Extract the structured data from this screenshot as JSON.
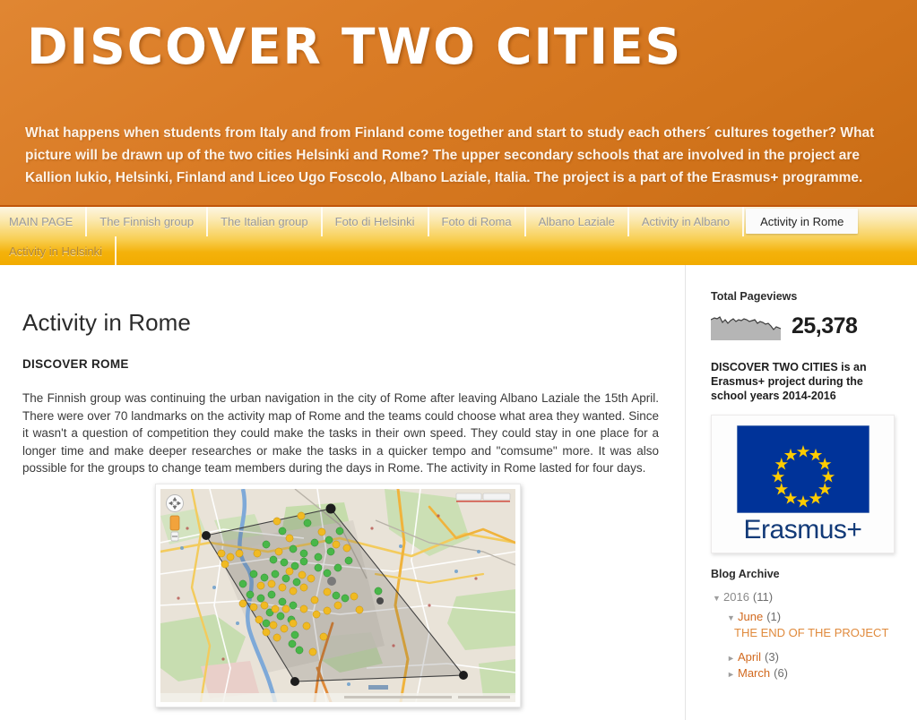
{
  "header": {
    "blog_title": "DISCOVER TWO CITIES",
    "description": "What happens when students from Italy and from Finland come together and start to study each others´ cultures together? What picture will be drawn up of the two cities Helsinki and Rome? The upper secondary schools that are involved in the project are Kallion lukio, Helsinki, Finland and Liceo Ugo Foscolo, Albano Laziale, Italia. The project is a part of the Erasmus+ programme.",
    "gradient_start": "#e08632",
    "gradient_end": "#c96c14"
  },
  "nav": {
    "row1": [
      {
        "label": "MAIN PAGE",
        "active": false
      },
      {
        "label": "The Finnish group",
        "active": false
      },
      {
        "label": "The Italian group",
        "active": false
      },
      {
        "label": "Foto di Helsinki",
        "active": false
      },
      {
        "label": "Foto di Roma",
        "active": false
      },
      {
        "label": "Albano Laziale",
        "active": false
      },
      {
        "label": "Activity in Albano",
        "active": false
      },
      {
        "label": "Activity in Rome",
        "active": true
      }
    ],
    "row2": [
      {
        "label": "Activity in Helsinki",
        "active": false
      }
    ],
    "bar_color_top": "#fdf6e2",
    "bar_color_bottom": "#f2ab00",
    "active_tab_bg": "#fbfbfb"
  },
  "post": {
    "title": "Activity in Rome",
    "subtitle": "DISCOVER ROME",
    "body": "The Finnish group was continuing the urban navigation in the city of Rome after leaving Albano Laziale the 15th April. There were over 70 landmarks on the activity map of Rome and the teams could choose what area they wanted. Since it wasn't a question of competition they could make the tasks in their own speed. They could stay in one place for a longer time and make deeper researches or make the tasks in a quicker tempo and \"comsume\" more. It was also possible for the groups to change team members during the days in Rome. The activity in Rome lasted for four days.",
    "image_alt": "Activity map of Rome with over 70 landmark markers"
  },
  "sidebar": {
    "pageviews": {
      "heading": "Total Pageviews",
      "count": "25,378",
      "chart_color": "#b5b5b5",
      "line_color": "#4a4a4a"
    },
    "project_note": "DISCOVER TWO CITIES is an Erasmus+ project during the school years 2014-2016",
    "erasmus": {
      "wordmark": "Erasmus+",
      "flag_blue": "#003399",
      "star_yellow": "#ffcc00",
      "text_color": "#123a78"
    },
    "archive": {
      "heading": "Blog Archive",
      "year": {
        "label": "2016",
        "count": "(11)",
        "marker": "▼"
      },
      "months": [
        {
          "label": "June",
          "count": "(1)",
          "marker": "▼",
          "expanded": true,
          "posts": [
            {
              "title": "THE END OF THE PROJECT"
            }
          ]
        },
        {
          "label": "April",
          "count": "(3)",
          "marker": "►",
          "expanded": false,
          "posts": []
        },
        {
          "label": "March",
          "count": "(6)",
          "marker": "►",
          "expanded": false,
          "posts": []
        }
      ],
      "link_color": "#d2691e"
    }
  }
}
